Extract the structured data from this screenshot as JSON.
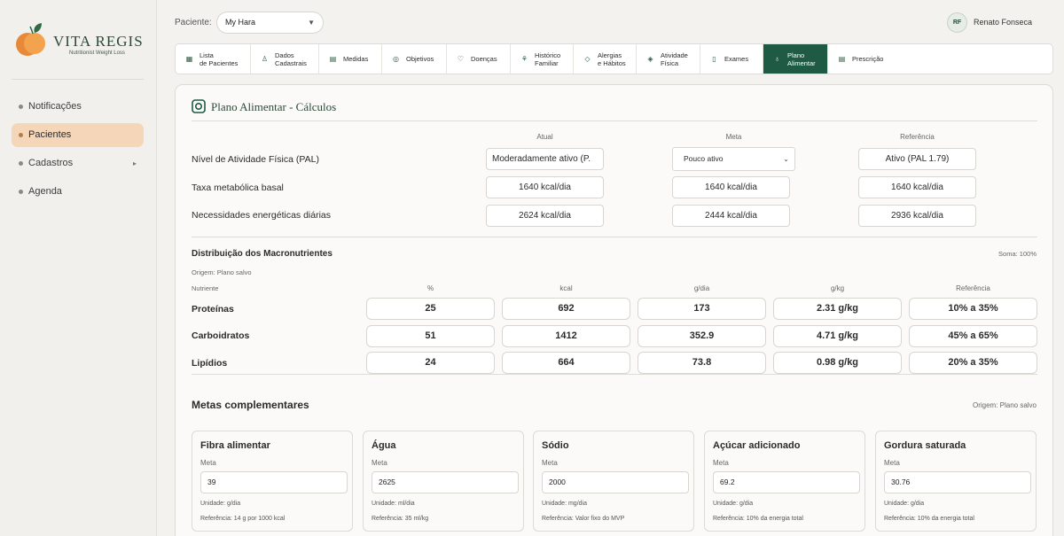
{
  "brand": {
    "title": "VITA REGIS",
    "subtitle": "Nutritionist Weight Loss"
  },
  "sidebar": {
    "items": [
      {
        "label": "Notificações"
      },
      {
        "label": "Pacientes"
      },
      {
        "label": "Cadastros",
        "caret": "▸"
      },
      {
        "label": "Agenda"
      }
    ]
  },
  "header": {
    "patient_label": "Paciente:",
    "patient_value": "My Hara",
    "user_initials": "RF",
    "user_name": "Renato Fonseca"
  },
  "tabs": [
    {
      "line1": "Lista",
      "line2": "de Pacientes",
      "icon": "▦"
    },
    {
      "line1": "Dados",
      "line2": "Cadastrais",
      "icon": "♙"
    },
    {
      "line1": "Medidas",
      "line2": "",
      "icon": "▤"
    },
    {
      "line1": "Objetivos",
      "line2": "",
      "icon": "◎"
    },
    {
      "line1": "Doenças",
      "line2": "",
      "icon": "♡"
    },
    {
      "line1": "Histórico",
      "line2": "Familiar",
      "icon": "⚘"
    },
    {
      "line1": "Alergias",
      "line2": "e Hábitos",
      "icon": "◇"
    },
    {
      "line1": "Atividade",
      "line2": "Física",
      "icon": "◈"
    },
    {
      "line1": "Exames",
      "line2": "",
      "icon": "▯"
    },
    {
      "line1": "Plano",
      "line2": "Alimentar",
      "icon": "♁",
      "active": true
    },
    {
      "line1": "Prescrição",
      "line2": "",
      "icon": "▤"
    }
  ],
  "plan": {
    "title": "Plano Alimentar - Cálculos",
    "columns": {
      "current": "Atual",
      "goal": "Meta",
      "reference": "Referência"
    },
    "rows": {
      "pal": {
        "label": "Nível de Atividade Física (PAL)",
        "current": "Moderadamente ativo (P.",
        "goal": "Pouco ativo",
        "reference": "Ativo (PAL 1.79)"
      },
      "bmr": {
        "label": "Taxa metabólica basal",
        "current": "1640 kcal/dia",
        "goal": "1640 kcal/dia",
        "reference": "1640 kcal/dia"
      },
      "energy": {
        "label": "Necessidades energéticas diárias",
        "current": "2624 kcal/dia",
        "goal": "2444 kcal/dia",
        "reference": "2936 kcal/dia"
      }
    }
  },
  "macros": {
    "title": "Distribuição dos Macronutrientes",
    "sum": "Soma: 100%",
    "origin": "Origem: Plano salvo",
    "headers": {
      "nutrient": "Nutriente",
      "pct": "%",
      "kcal": "kcal",
      "gday": "g/dia",
      "gkg": "g/kg",
      "ref": "Referência"
    },
    "rows": [
      {
        "name": "Proteínas",
        "pct": "25",
        "kcal": "692",
        "gday": "173",
        "gkg": "2.31 g/kg",
        "ref": "10% a 35%"
      },
      {
        "name": "Carboidratos",
        "pct": "51",
        "kcal": "1412",
        "gday": "352.9",
        "gkg": "4.71 g/kg",
        "ref": "45% a 65%"
      },
      {
        "name": "Lipídios",
        "pct": "24",
        "kcal": "664",
        "gday": "73.8",
        "gkg": "0.98 g/kg",
        "ref": "20% a 35%"
      }
    ]
  },
  "goals": {
    "title": "Metas complementares",
    "origin": "Origem: Plano salvo",
    "meta_label": "Meta",
    "cards": [
      {
        "title": "Fibra alimentar",
        "value": "39",
        "unit": "Unidade: g/dia",
        "ref": "Referência: 14 g por 1000 kcal"
      },
      {
        "title": "Água",
        "value": "2625",
        "unit": "Unidade: ml/dia",
        "ref": "Referência: 35 ml/kg"
      },
      {
        "title": "Sódio",
        "value": "2000",
        "unit": "Unidade: mg/dia",
        "ref": "Referência: Valor fixo do MVP"
      },
      {
        "title": "Açúcar adicionado",
        "value": "69.2",
        "unit": "Unidade: g/dia",
        "ref": "Referência: 10% da energia total"
      },
      {
        "title": "Gordura saturada",
        "value": "30.76",
        "unit": "Unidade: g/dia",
        "ref": "Referência: 10% da energia total"
      }
    ]
  },
  "colors": {
    "primary": "#1f5a44",
    "accent": "#f6d6b8",
    "brand_orange": "#e8893a"
  }
}
